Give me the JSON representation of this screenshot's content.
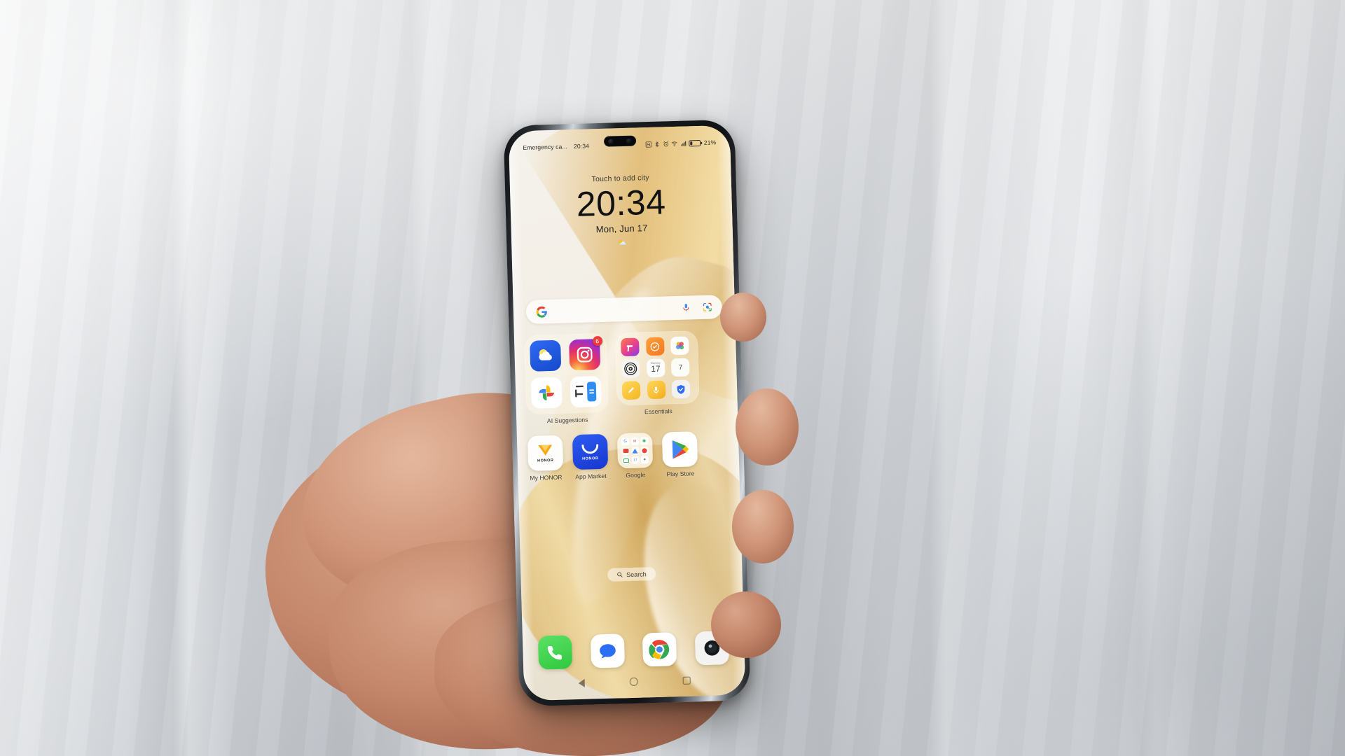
{
  "scene": {
    "description": "Hand holding an HONOR smartphone displaying its home screen against a white fabric backdrop",
    "backdrop_color": "#d3d7dc",
    "skin_color": "#c4866a"
  },
  "phone": {
    "frame_color": "#15181b",
    "screen_bg": "#f2eee5",
    "wallpaper_accent": "#d8b26a"
  },
  "status_bar": {
    "carrier": "Emergency ca...",
    "time": "20:34",
    "icons": [
      "nfc-icon",
      "bluetooth-icon",
      "alarm-icon",
      "wifi-icon",
      "signal-icon",
      "battery-icon"
    ],
    "battery_percent": "21%",
    "battery_level": 21
  },
  "clock_widget": {
    "add_city": "Touch to add city",
    "time": "20:34",
    "date": "Mon, Jun 17",
    "weather_glyph": "⛅"
  },
  "search_widget": {
    "logo": "google-g-icon",
    "mic": "microphone-icon",
    "lens": "google-lens-icon"
  },
  "folders": [
    {
      "name": "ai_suggestions",
      "label": "AI Suggestions",
      "apps": [
        {
          "name": "Weather",
          "icon": "weather-icon",
          "badge": ""
        },
        {
          "name": "Instagram",
          "icon": "instagram-icon",
          "badge": "6"
        },
        {
          "name": "Google Photos",
          "icon": "photos-icon",
          "badge": ""
        },
        {
          "name": "Calculator",
          "icon": "calculator-icon",
          "badge": ""
        }
      ]
    },
    {
      "name": "essentials",
      "label": "Essentials",
      "apps": [
        {
          "name": "Themes",
          "icon": "themes-icon"
        },
        {
          "name": "Health",
          "icon": "health-icon"
        },
        {
          "name": "Gallery",
          "icon": "gallery-icon"
        },
        {
          "name": "Compass",
          "icon": "compass-icon"
        },
        {
          "name": "Calendar",
          "icon": "calendar-icon",
          "month": "Monday",
          "day": "17"
        },
        {
          "name": "Weather",
          "icon": "weather-small-icon",
          "temp": "7"
        },
        {
          "name": "Notes",
          "icon": "notes-icon"
        },
        {
          "name": "Recorder",
          "icon": "recorder-icon"
        },
        {
          "name": "Security",
          "icon": "security-icon"
        }
      ]
    }
  ],
  "app_row": [
    {
      "name": "My HONOR",
      "label": "My HONOR",
      "icon": "my-honor-icon",
      "brand": "HONOR"
    },
    {
      "name": "App Market",
      "label": "App Market",
      "icon": "app-market-icon",
      "brand": "HONOR"
    },
    {
      "name": "Google",
      "label": "Google",
      "icon": "google-folder-icon"
    },
    {
      "name": "Play Store",
      "label": "Play Store",
      "icon": "play-store-icon"
    }
  ],
  "search_pill": {
    "icon": "search-icon",
    "label": "Search"
  },
  "dock": [
    {
      "name": "Phone",
      "icon": "phone-icon"
    },
    {
      "name": "Messages",
      "icon": "messages-icon"
    },
    {
      "name": "Chrome",
      "icon": "chrome-icon"
    },
    {
      "name": "Camera",
      "icon": "camera-icon"
    }
  ],
  "nav_bar": [
    {
      "name": "Back",
      "icon": "back-triangle-icon"
    },
    {
      "name": "Home",
      "icon": "home-circle-icon"
    },
    {
      "name": "Recents",
      "icon": "recents-square-icon"
    }
  ]
}
